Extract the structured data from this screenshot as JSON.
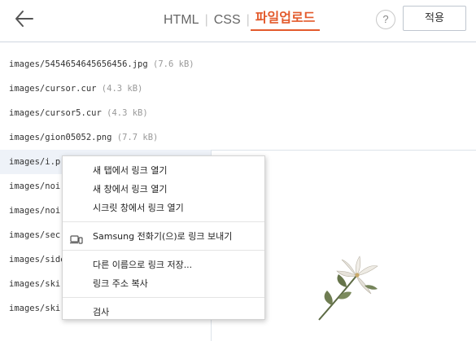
{
  "header": {
    "tabs": [
      {
        "label": "HTML"
      },
      {
        "label": "CSS"
      },
      {
        "label": "파일업로드"
      }
    ],
    "help_label": "?",
    "apply_label": "적용"
  },
  "files": [
    {
      "name": "images/5454654645656456.jpg",
      "size": "(7.6 kB)"
    },
    {
      "name": "images/cursor.cur",
      "size": "(4.3 kB)"
    },
    {
      "name": "images/cursor5.cur",
      "size": "(4.3 kB)"
    },
    {
      "name": "images/gion05052.png",
      "size": "(7.7 kB)"
    },
    {
      "name": "images/i.pr",
      "size": ""
    },
    {
      "name": "images/noir",
      "size": ""
    },
    {
      "name": "images/noir",
      "size": ""
    },
    {
      "name": "images/secr",
      "size": ""
    },
    {
      "name": "images/side",
      "size": ""
    },
    {
      "name": "images/skir",
      "size": ""
    },
    {
      "name": "images/skir",
      "size": ""
    }
  ],
  "context_menu": {
    "open_new_tab": "새 탭에서 링크 열기",
    "open_new_window": "새 창에서 링크 열기",
    "open_incognito": "시크릿 창에서 링크 열기",
    "send_to_device": "Samsung 전화기(으)로 링크 보내기",
    "save_link_as": "다른 이름으로 링크 저장...",
    "copy_link": "링크 주소 복사",
    "inspect": "검사"
  },
  "colors": {
    "accent": "#e35a2c",
    "selected_row": "#eef2f8",
    "header_border": "#cfd6e0"
  }
}
